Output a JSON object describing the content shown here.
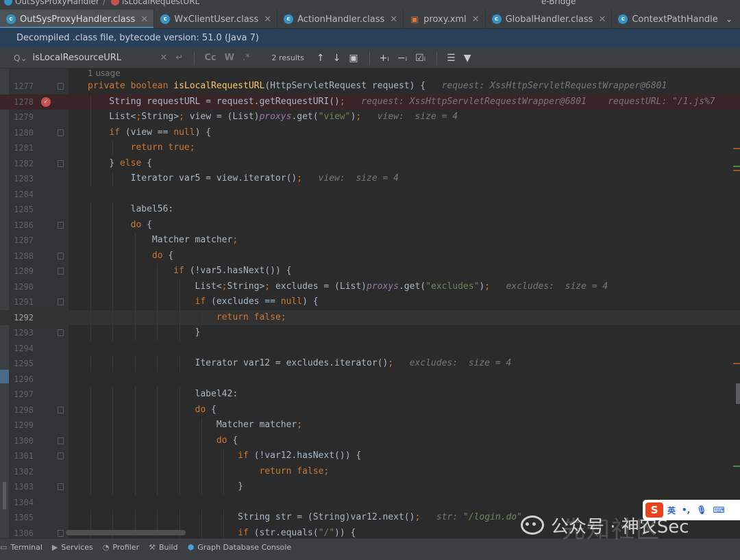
{
  "breadcrumb": {
    "item1": "OutSysProxyHandler",
    "item2": "isLocalRequestURL",
    "config": "e-Bridge"
  },
  "tabs": [
    {
      "label": "OutSysProxyHandler.class",
      "icon": "class-icon",
      "active": true,
      "closable": true
    },
    {
      "label": "WxClientUser.class",
      "icon": "class-icon",
      "active": false,
      "closable": true
    },
    {
      "label": "ActionHandler.class",
      "icon": "class-icon",
      "active": false,
      "closable": true
    },
    {
      "label": "proxy.xml",
      "icon": "xml-icon",
      "active": false,
      "closable": true
    },
    {
      "label": "GlobalHandler.class",
      "icon": "class-icon",
      "active": false,
      "closable": true
    },
    {
      "label": "ContextPathHandler.class",
      "icon": "class-icon",
      "active": false,
      "closable": true
    }
  ],
  "banner": {
    "text": "Decompiled .class file, bytecode version: 51.0 (Java 7)"
  },
  "search": {
    "value": "isLocalResourceURL",
    "results": "2 results",
    "match_case": "Cc",
    "words": "W",
    "regex": ".*"
  },
  "editor": {
    "usage_hint": "1 usage",
    "current_line": 1292,
    "breakpoint_line": 1278
  },
  "code_lines": [
    {
      "n": "1277",
      "text": "private boolean isLocalRequestURL(HttpServletRequest request) {   request: XssHttpServletRequestWrapper@6801"
    },
    {
      "n": "1278",
      "text": "    String requestURL = request.getRequestURI();   request: XssHttpServletRequestWrapper@6801    requestURL: \"/1.js%7"
    },
    {
      "n": "1279",
      "text": "    List<String> view = (List)proxys.get(\"view\");   view:  size = 4"
    },
    {
      "n": "1280",
      "text": "    if (view == null) {"
    },
    {
      "n": "1281",
      "text": "        return true;"
    },
    {
      "n": "1282",
      "text": "    } else {"
    },
    {
      "n": "1283",
      "text": "        Iterator var5 = view.iterator();   view:  size = 4"
    },
    {
      "n": "1284",
      "text": ""
    },
    {
      "n": "1285",
      "text": "        label56:"
    },
    {
      "n": "1286",
      "text": "        do {"
    },
    {
      "n": "1287",
      "text": "            Matcher matcher;"
    },
    {
      "n": "1288",
      "text": "            do {"
    },
    {
      "n": "1289",
      "text": "                if (!var5.hasNext()) {"
    },
    {
      "n": "1290",
      "text": "                    List<String> excludes = (List)proxys.get(\"excludes\");   excludes:  size = 4"
    },
    {
      "n": "1291",
      "text": "                    if (excludes == null) {"
    },
    {
      "n": "1292",
      "text": "                        return false;"
    },
    {
      "n": "1293",
      "text": "                    }"
    },
    {
      "n": "1294",
      "text": ""
    },
    {
      "n": "1295",
      "text": "                    Iterator var12 = excludes.iterator();   excludes:  size = 4"
    },
    {
      "n": "1296",
      "text": ""
    },
    {
      "n": "1297",
      "text": "                    label42:"
    },
    {
      "n": "1298",
      "text": "                    do {"
    },
    {
      "n": "1299",
      "text": "                        Matcher matcher;"
    },
    {
      "n": "1300",
      "text": "                        do {"
    },
    {
      "n": "1301",
      "text": "                            if (!var12.hasNext()) {"
    },
    {
      "n": "1302",
      "text": "                                return false;"
    },
    {
      "n": "1303",
      "text": "                            }"
    },
    {
      "n": "1304",
      "text": ""
    },
    {
      "n": "1305",
      "text": "                            String str = (String)var12.next();   str: \"/login.do\""
    },
    {
      "n": "1306",
      "text": "                            if (str.equals(\"/\")) {"
    }
  ],
  "toolwindows": [
    {
      "label": "Terminal",
      "icon": "terminal-icon"
    },
    {
      "label": "Services",
      "icon": "services-icon"
    },
    {
      "label": "Profiler",
      "icon": "profiler-icon"
    },
    {
      "label": "Build",
      "icon": "build-icon"
    },
    {
      "label": "Graph Database Console",
      "icon": "graph-icon"
    }
  ],
  "watermark": {
    "text": "公众号 · 神农Sec",
    "logo_text": "先知社区"
  },
  "ime": {
    "label": "英"
  },
  "colors": {
    "keyword": "#cc7832",
    "method": "#ffc66d",
    "string": "#6a8759",
    "static_field": "#9876aa",
    "hint": "#787878",
    "accent": "#4a88c7"
  }
}
